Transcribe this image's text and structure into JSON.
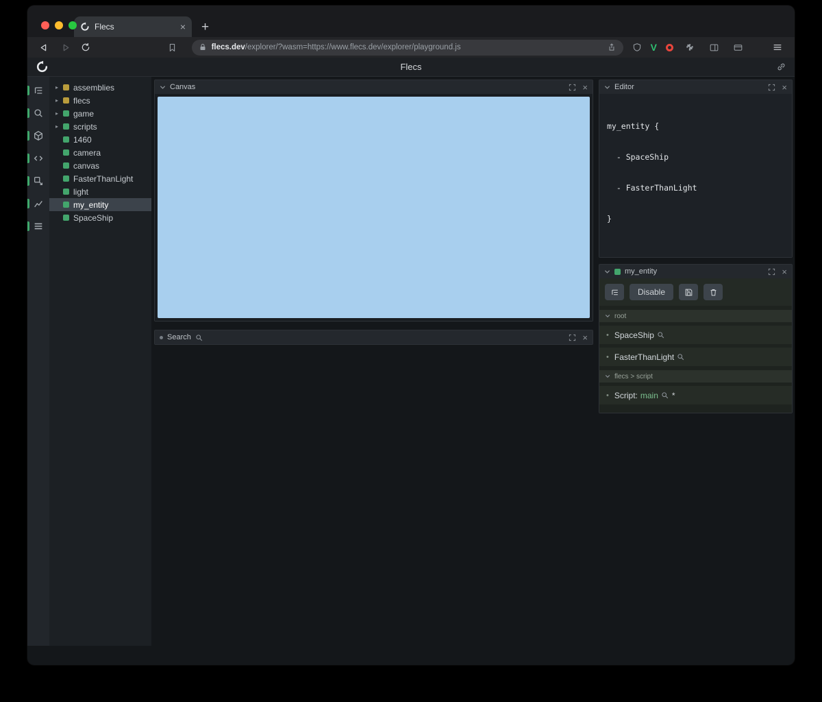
{
  "glyphs": {
    "close_tab": "×",
    "new_tab": "+",
    "panel_close": "×",
    "tree_arrow": "▸",
    "bullet": "•",
    "star": "*",
    "ext_v": "V"
  },
  "colors": {
    "canvas_blue": "#a8cfee",
    "entity_green": "#43a56c",
    "module_yellow": "#b99c3c",
    "selected_row": "#3c434b"
  },
  "browser": {
    "tab_title": "Flecs",
    "url_host": "flecs.dev",
    "url_rest": "/explorer/?wasm=https://www.flecs.dev/explorer/playground.js"
  },
  "app": {
    "title": "Flecs",
    "sidebar_tools": [
      "entity-tree",
      "search",
      "entities",
      "code",
      "inspect",
      "charts",
      "stats"
    ],
    "tree": {
      "items": [
        {
          "label": "assemblies",
          "type": "module",
          "expandable": true
        },
        {
          "label": "flecs",
          "type": "module",
          "expandable": true
        },
        {
          "label": "game",
          "type": "entity",
          "expandable": true
        },
        {
          "label": "scripts",
          "type": "entity",
          "expandable": true
        },
        {
          "label": "1460",
          "type": "entity"
        },
        {
          "label": "camera",
          "type": "entity"
        },
        {
          "label": "canvas",
          "type": "entity"
        },
        {
          "label": "FasterThanLight",
          "type": "entity"
        },
        {
          "label": "light",
          "type": "entity"
        },
        {
          "label": "my_entity",
          "type": "entity",
          "selected": true
        },
        {
          "label": "SpaceShip",
          "type": "entity"
        }
      ]
    },
    "canvas_panel": {
      "title": "Canvas"
    },
    "search_panel": {
      "title": "Search"
    },
    "editor_panel": {
      "title": "Editor",
      "lines": [
        "my_entity {",
        "  - SpaceShip",
        "  - FasterThanLight",
        "}"
      ]
    },
    "inspector": {
      "title": "my_entity",
      "disable_label": "Disable",
      "sections": [
        {
          "label": "root",
          "items": [
            {
              "name": "SpaceShip"
            },
            {
              "name": "FasterThanLight"
            }
          ]
        },
        {
          "label": "flecs > script",
          "items": [
            {
              "prefix": "Script:",
              "value": "main"
            }
          ]
        }
      ]
    }
  }
}
